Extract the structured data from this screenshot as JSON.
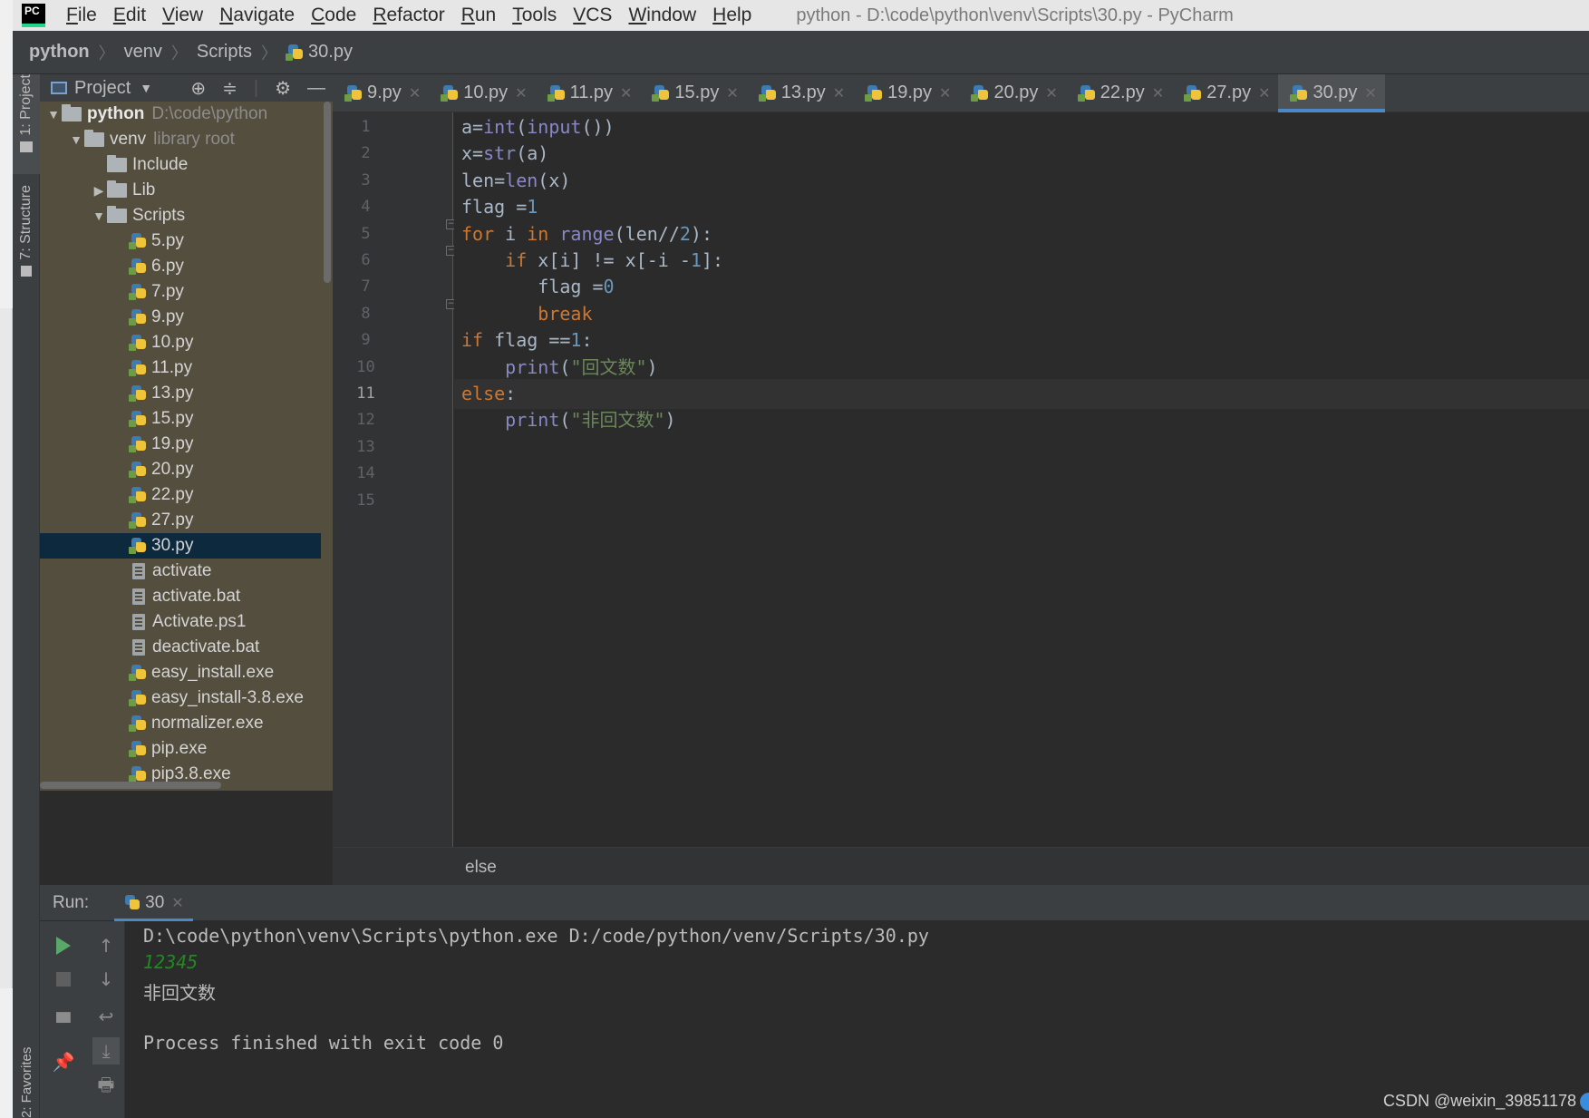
{
  "window": {
    "title": "python - D:\\code\\python\\venv\\Scripts\\30.py - PyCharm",
    "logo_text": "PC"
  },
  "menu": [
    {
      "label": "File",
      "key": "F",
      "rest": "ile"
    },
    {
      "label": "Edit",
      "key": "E",
      "rest": "dit"
    },
    {
      "label": "View",
      "key": "V",
      "rest": "iew"
    },
    {
      "label": "Navigate",
      "key": "N",
      "rest": "avigate"
    },
    {
      "label": "Code",
      "key": "C",
      "rest": "ode"
    },
    {
      "label": "Refactor",
      "key": "R",
      "rest": "efactor"
    },
    {
      "label": "Run",
      "key": "R",
      "rest": "un"
    },
    {
      "label": "Tools",
      "key": "T",
      "rest": "ools"
    },
    {
      "label": "VCS",
      "key": "V",
      "rest": "CS"
    },
    {
      "label": "Window",
      "key": "W",
      "rest": "indow"
    },
    {
      "label": "Help",
      "key": "H",
      "rest": "elp"
    }
  ],
  "breadcrumb": [
    "python",
    "venv",
    "Scripts",
    "30.py"
  ],
  "left_stripe": {
    "project": "1: Project",
    "structure": "7: Structure",
    "favorites": "2: Favorites"
  },
  "project_panel": {
    "title": "Project",
    "tree": [
      {
        "label": "python",
        "hint": "D:\\code\\python",
        "type": "folder",
        "depth": 0,
        "arrow": "▼",
        "bold": true
      },
      {
        "label": "venv",
        "hint": "library root",
        "type": "folder",
        "depth": 1,
        "arrow": "▼"
      },
      {
        "label": "Include",
        "type": "folder",
        "depth": 2,
        "arrow": ""
      },
      {
        "label": "Lib",
        "type": "folder",
        "depth": 2,
        "arrow": "▶"
      },
      {
        "label": "Scripts",
        "type": "folder",
        "depth": 2,
        "arrow": "▼"
      },
      {
        "label": "5.py",
        "type": "py",
        "depth": 3
      },
      {
        "label": "6.py",
        "type": "py",
        "depth": 3
      },
      {
        "label": "7.py",
        "type": "py",
        "depth": 3
      },
      {
        "label": "9.py",
        "type": "py",
        "depth": 3
      },
      {
        "label": "10.py",
        "type": "py",
        "depth": 3
      },
      {
        "label": "11.py",
        "type": "py",
        "depth": 3
      },
      {
        "label": "13.py",
        "type": "py",
        "depth": 3
      },
      {
        "label": "15.py",
        "type": "py",
        "depth": 3
      },
      {
        "label": "19.py",
        "type": "py",
        "depth": 3
      },
      {
        "label": "20.py",
        "type": "py",
        "depth": 3
      },
      {
        "label": "22.py",
        "type": "py",
        "depth": 3
      },
      {
        "label": "27.py",
        "type": "py",
        "depth": 3
      },
      {
        "label": "30.py",
        "type": "py",
        "depth": 3,
        "selected": true
      },
      {
        "label": "activate",
        "type": "file",
        "depth": 3
      },
      {
        "label": "activate.bat",
        "type": "file",
        "depth": 3
      },
      {
        "label": "Activate.ps1",
        "type": "file",
        "depth": 3
      },
      {
        "label": "deactivate.bat",
        "type": "file",
        "depth": 3
      },
      {
        "label": "easy_install.exe",
        "type": "py",
        "depth": 3
      },
      {
        "label": "easy_install-3.8.exe",
        "type": "py",
        "depth": 3
      },
      {
        "label": "normalizer.exe",
        "type": "py",
        "depth": 3
      },
      {
        "label": "pip.exe",
        "type": "py",
        "depth": 3
      },
      {
        "label": "pip3.8.exe",
        "type": "py",
        "depth": 3
      }
    ]
  },
  "editor_tabs": [
    {
      "label": "9.py"
    },
    {
      "label": "10.py"
    },
    {
      "label": "11.py"
    },
    {
      "label": "15.py"
    },
    {
      "label": "13.py"
    },
    {
      "label": "19.py"
    },
    {
      "label": "20.py"
    },
    {
      "label": "22.py"
    },
    {
      "label": "27.py"
    },
    {
      "label": "30.py",
      "active": true
    }
  ],
  "editor": {
    "current_line": 11,
    "line_numbers": [
      "1",
      "2",
      "3",
      "4",
      "5",
      "6",
      "7",
      "8",
      "9",
      "10",
      "11",
      "12",
      "13",
      "14",
      "15"
    ],
    "lines": [
      [
        {
          "t": "a="
        },
        {
          "t": "int",
          "c": "bi"
        },
        {
          "t": "("
        },
        {
          "t": "input",
          "c": "bi"
        },
        {
          "t": "())"
        }
      ],
      [
        {
          "t": "x="
        },
        {
          "t": "str",
          "c": "bi"
        },
        {
          "t": "(a)"
        }
      ],
      [
        {
          "t": "len="
        },
        {
          "t": "len",
          "c": "bi"
        },
        {
          "t": "(x)"
        }
      ],
      [
        {
          "t": "flag ="
        },
        {
          "t": "1",
          "c": "num"
        }
      ],
      [
        {
          "t": "for ",
          "c": "kw"
        },
        {
          "t": "i "
        },
        {
          "t": "in ",
          "c": "kw"
        },
        {
          "t": "range",
          "c": "bi"
        },
        {
          "t": "(len//"
        },
        {
          "t": "2",
          "c": "num"
        },
        {
          "t": "):"
        }
      ],
      [
        {
          "t": "    "
        },
        {
          "t": "if ",
          "c": "kw"
        },
        {
          "t": "x[i] != x[-i -"
        },
        {
          "t": "1",
          "c": "num"
        },
        {
          "t": "]:"
        }
      ],
      [
        {
          "t": "       flag ="
        },
        {
          "t": "0",
          "c": "num"
        }
      ],
      [
        {
          "t": "       "
        },
        {
          "t": "break",
          "c": "kw"
        }
      ],
      [
        {
          "t": "if ",
          "c": "kw"
        },
        {
          "t": "flag =="
        },
        {
          "t": "1",
          "c": "num"
        },
        {
          "t": ":"
        }
      ],
      [
        {
          "t": "    "
        },
        {
          "t": "print",
          "c": "bi"
        },
        {
          "t": "("
        },
        {
          "t": "\"回文数\"",
          "c": "str"
        },
        {
          "t": ")"
        }
      ],
      [
        {
          "t": "else",
          "c": "kw"
        },
        {
          "t": ":"
        }
      ],
      [
        {
          "t": "    "
        },
        {
          "t": "print",
          "c": "bi"
        },
        {
          "t": "("
        },
        {
          "t": "\"非回文数\"",
          "c": "str"
        },
        {
          "t": ")"
        }
      ],
      [],
      [],
      []
    ],
    "status_crumb": "else"
  },
  "run_panel": {
    "label": "Run:",
    "tab": "30",
    "console": [
      {
        "text": "D:\\code\\python\\venv\\Scripts\\python.exe D:/code/python/venv/Scripts/30.py",
        "kind": "cmd"
      },
      {
        "text": "12345",
        "kind": "input"
      },
      {
        "text": "非回文数",
        "kind": "out"
      },
      {
        "text": "",
        "kind": "out"
      },
      {
        "text": "Process finished with exit code 0",
        "kind": "out"
      }
    ]
  },
  "watermark": "CSDN @weixin_39851178",
  "colors": {
    "keyword": "#cc7832",
    "builtin": "#8888c6",
    "number": "#6897bb",
    "string": "#6a8759",
    "selection": "#0d293e",
    "accent": "#4a88c7"
  }
}
